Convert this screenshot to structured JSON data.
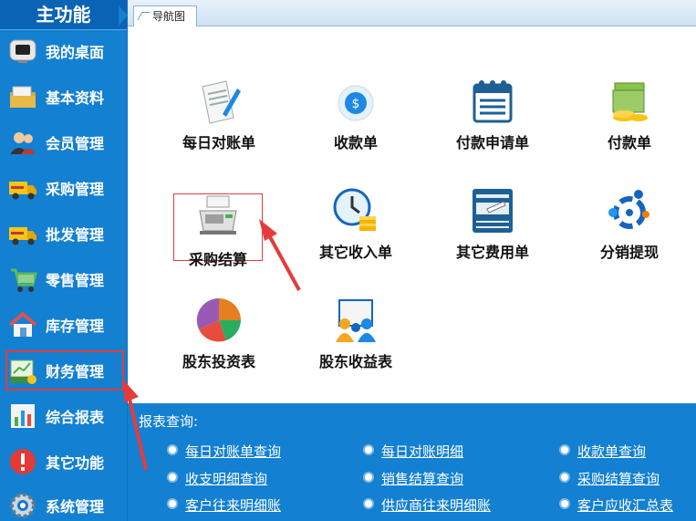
{
  "sidebar": {
    "title": "主功能",
    "items": [
      {
        "label": "我的桌面",
        "icon": "monitor-icon"
      },
      {
        "label": "基本资料",
        "icon": "folder-icon"
      },
      {
        "label": "会员管理",
        "icon": "members-icon"
      },
      {
        "label": "采购管理",
        "icon": "truck-icon"
      },
      {
        "label": "批发管理",
        "icon": "truck-icon"
      },
      {
        "label": "零售管理",
        "icon": "cart-icon"
      },
      {
        "label": "库存管理",
        "icon": "house-icon"
      },
      {
        "label": "财务管理",
        "icon": "money-icon"
      },
      {
        "label": "综合报表",
        "icon": "bar-chart-icon"
      },
      {
        "label": "其它功能",
        "icon": "alert-icon"
      },
      {
        "label": "系统管理",
        "icon": "gear-icon"
      }
    ]
  },
  "tabs": [
    {
      "label": "导航图"
    }
  ],
  "tiles": [
    {
      "label": "每日对账单",
      "icon": "document-pen-icon"
    },
    {
      "label": "收款单",
      "icon": "money-bag-icon"
    },
    {
      "label": "付款申请单",
      "icon": "notepad-icon"
    },
    {
      "label": "付款单",
      "icon": "cash-icon"
    },
    {
      "label": "采购结算",
      "icon": "cash-register-icon"
    },
    {
      "label": "其它收入单",
      "icon": "clock-coins-icon"
    },
    {
      "label": "其它费用单",
      "icon": "card-icon"
    },
    {
      "label": "分销提现",
      "icon": "distribution-icon"
    },
    {
      "label": "股东投资表",
      "icon": "pie-chart-icon"
    },
    {
      "label": "股东收益表",
      "icon": "people-board-icon"
    }
  ],
  "reports": {
    "title": "报表查询:",
    "links": [
      [
        "每日对账单查询",
        "每日对账明细",
        "收款单查询"
      ],
      [
        "收支明细查询",
        "销售结算查询",
        "采购结算查询"
      ],
      [
        "客户往来明细账",
        "供应商往来明细账",
        "客户应收汇总表"
      ]
    ]
  }
}
